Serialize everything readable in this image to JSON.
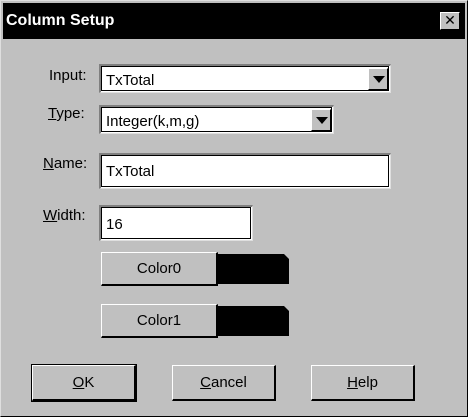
{
  "window": {
    "title": "Column Setup",
    "close_glyph": "✕"
  },
  "fields": {
    "input": {
      "label": "Input:",
      "value": "TxTotal"
    },
    "type": {
      "label_mnemonic": "T",
      "label_rest": "ype:",
      "value": "Integer(k,m,g)"
    },
    "name": {
      "label_mnemonic": "N",
      "label_rest": "ame:",
      "value": "TxTotal"
    },
    "width": {
      "label_mnemonic": "W",
      "label_rest": "idth:",
      "value": "16"
    }
  },
  "colors": [
    {
      "label": "Color0",
      "swatch": "#000000"
    },
    {
      "label": "Color1",
      "swatch": "#000000"
    }
  ],
  "buttons": {
    "ok": {
      "mnemonic": "O",
      "rest": "K"
    },
    "cancel": {
      "mnemonic": "C",
      "rest": "ancel"
    },
    "help": {
      "mnemonic": "H",
      "rest": "elp"
    }
  },
  "theme": {
    "dialog_bg": "#c0c0c0",
    "titlebar_bg": "#000000",
    "titlebar_text": "#ffffff",
    "field_bg": "#ffffff"
  }
}
